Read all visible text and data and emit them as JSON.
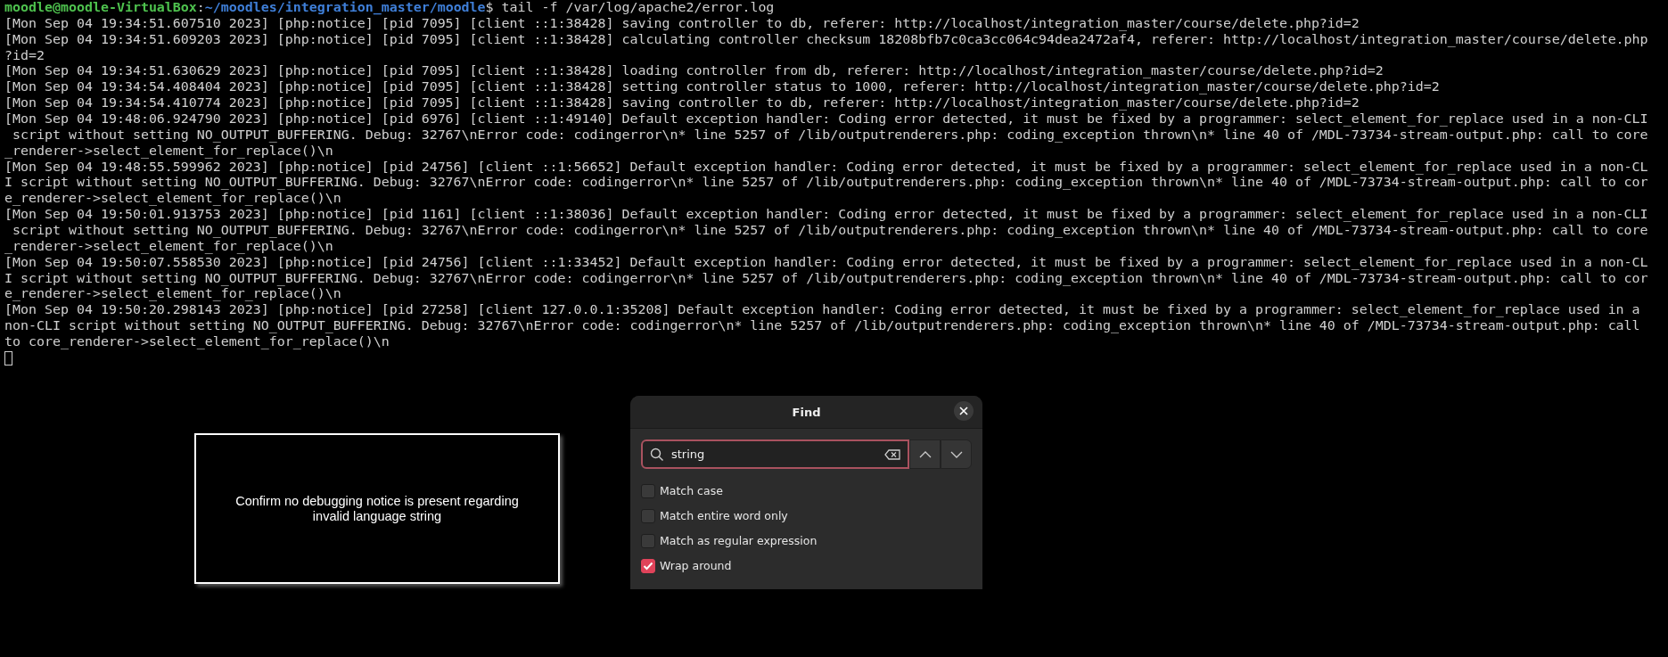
{
  "terminal": {
    "prompt": {
      "user_host": "moodle@moodle-VirtualBox",
      "separator": ":",
      "path": "~/moodles/integration_master/moodle",
      "command": "$ tail -f /var/log/apache2/error.log"
    },
    "lines": [
      "[Mon Sep 04 19:34:51.607510 2023] [php:notice] [pid 7095] [client ::1:38428] saving controller to db, referer: http://localhost/integration_master/course/delete.php?id=2",
      "[Mon Sep 04 19:34:51.609203 2023] [php:notice] [pid 7095] [client ::1:38428] calculating controller checksum 18208bfb7c0ca3cc064c94dea2472af4, referer: http://localhost/integration_master/course/delete.php",
      "?id=2",
      "[Mon Sep 04 19:34:51.630629 2023] [php:notice] [pid 7095] [client ::1:38428] loading controller from db, referer: http://localhost/integration_master/course/delete.php?id=2",
      "[Mon Sep 04 19:34:54.408404 2023] [php:notice] [pid 7095] [client ::1:38428] setting controller status to 1000, referer: http://localhost/integration_master/course/delete.php?id=2",
      "[Mon Sep 04 19:34:54.410774 2023] [php:notice] [pid 7095] [client ::1:38428] saving controller to db, referer: http://localhost/integration_master/course/delete.php?id=2",
      "[Mon Sep 04 19:48:06.924790 2023] [php:notice] [pid 6976] [client ::1:49140] Default exception handler: Coding error detected, it must be fixed by a programmer: select_element_for_replace used in a non-CLI",
      " script without setting NO_OUTPUT_BUFFERING. Debug: 32767\\nError code: codingerror\\n* line 5257 of /lib/outputrenderers.php: coding_exception thrown\\n* line 40 of /MDL-73734-stream-output.php: call to core",
      "_renderer->select_element_for_replace()\\n",
      "[Mon Sep 04 19:48:55.599962 2023] [php:notice] [pid 24756] [client ::1:56652] Default exception handler: Coding error detected, it must be fixed by a programmer: select_element_for_replace used in a non-CL",
      "I script without setting NO_OUTPUT_BUFFERING. Debug: 32767\\nError code: codingerror\\n* line 5257 of /lib/outputrenderers.php: coding_exception thrown\\n* line 40 of /MDL-73734-stream-output.php: call to cor",
      "e_renderer->select_element_for_replace()\\n",
      "[Mon Sep 04 19:50:01.913753 2023] [php:notice] [pid 1161] [client ::1:38036] Default exception handler: Coding error detected, it must be fixed by a programmer: select_element_for_replace used in a non-CLI",
      " script without setting NO_OUTPUT_BUFFERING. Debug: 32767\\nError code: codingerror\\n* line 5257 of /lib/outputrenderers.php: coding_exception thrown\\n* line 40 of /MDL-73734-stream-output.php: call to core",
      "_renderer->select_element_for_replace()\\n",
      "[Mon Sep 04 19:50:07.558530 2023] [php:notice] [pid 24756] [client ::1:33452] Default exception handler: Coding error detected, it must be fixed by a programmer: select_element_for_replace used in a non-CL",
      "I script without setting NO_OUTPUT_BUFFERING. Debug: 32767\\nError code: codingerror\\n* line 5257 of /lib/outputrenderers.php: coding_exception thrown\\n* line 40 of /MDL-73734-stream-output.php: call to cor",
      "e_renderer->select_element_for_replace()\\n",
      "[Mon Sep 04 19:50:20.298143 2023] [php:notice] [pid 27258] [client 127.0.0.1:35208] Default exception handler: Coding error detected, it must be fixed by a programmer: select_element_for_replace used in a",
      "non-CLI script without setting NO_OUTPUT_BUFFERING. Debug: 32767\\nError code: codingerror\\n* line 5257 of /lib/outputrenderers.php: coding_exception thrown\\n* line 40 of /MDL-73734-stream-output.php: call",
      "to core_renderer->select_element_for_replace()\\n"
    ]
  },
  "note": {
    "text": "Confirm no debugging notice is present regarding invalid language string"
  },
  "find_dialog": {
    "title": "Find",
    "search": {
      "value": "string"
    },
    "options": [
      {
        "label": "Match case",
        "checked": false
      },
      {
        "label": "Match entire word only",
        "checked": false
      },
      {
        "label": "Match as regular expression",
        "checked": false
      },
      {
        "label": "Wrap around",
        "checked": true
      }
    ]
  }
}
